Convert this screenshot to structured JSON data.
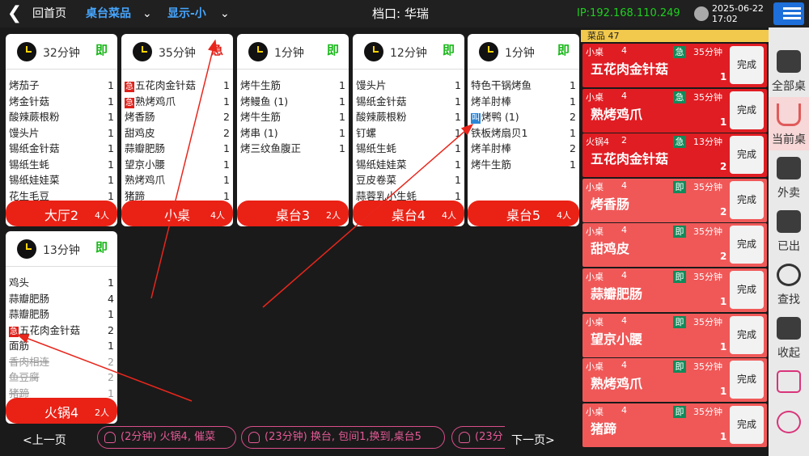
{
  "topbar": {
    "back": "❮",
    "home": "回首页",
    "menu": "桌台菜品",
    "display": "显示-小",
    "chevron": "⌄",
    "stall": "档口: 华瑞",
    "ip": "IP:192.168.110.249",
    "date": "2025-06-22",
    "time": "17:02"
  },
  "cards": [
    {
      "minutes": "32分钟",
      "tag": "即",
      "table": "大厅2",
      "people": "4人",
      "items": [
        {
          "n": "烤茄子",
          "q": "1"
        },
        {
          "n": "烤金针菇",
          "q": "1"
        },
        {
          "n": "酸辣蕨根粉",
          "q": "1"
        },
        {
          "n": "馒头片",
          "q": "1"
        },
        {
          "n": "锡纸金针菇",
          "q": "1"
        },
        {
          "n": "锡纸生蚝",
          "q": "1"
        },
        {
          "n": "锡纸娃娃菜",
          "q": "1"
        },
        {
          "n": "花生毛豆",
          "q": "1"
        }
      ]
    },
    {
      "minutes": "35分钟",
      "tag": "急",
      "table": "小桌",
      "people": "4人",
      "items": [
        {
          "b": "急",
          "n": "五花肉金针菇",
          "q": "1"
        },
        {
          "b": "急",
          "n": "熟烤鸡爪",
          "q": "1"
        },
        {
          "n": "烤香肠",
          "q": "2"
        },
        {
          "n": "甜鸡皮",
          "q": "2"
        },
        {
          "n": "蒜瓣肥肠",
          "q": "1"
        },
        {
          "n": "望京小腰",
          "q": "1"
        },
        {
          "n": "熟烤鸡爪",
          "q": "1"
        },
        {
          "n": "猪蹄",
          "q": "1"
        }
      ]
    },
    {
      "minutes": "1分钟",
      "tag": "即",
      "table": "桌台3",
      "people": "2人",
      "items": [
        {
          "n": "烤牛生筋",
          "q": "1"
        },
        {
          "n": "烤鳗鱼 (1)",
          "q": "1"
        },
        {
          "n": "烤牛生筋",
          "q": "1"
        },
        {
          "n": "烤串 (1)",
          "q": "1"
        },
        {
          "n": "烤三纹鱼腹正",
          "q": "1"
        }
      ]
    },
    {
      "minutes": "12分钟",
      "tag": "即",
      "table": "桌台4",
      "people": "4人",
      "items": [
        {
          "n": "馒头片",
          "q": "1"
        },
        {
          "n": "锡纸金针菇",
          "q": "1"
        },
        {
          "n": "酸辣蕨根粉",
          "q": "1"
        },
        {
          "n": "钉螺",
          "q": "1"
        },
        {
          "n": "锡纸生蚝",
          "q": "1"
        },
        {
          "n": "锡纸娃娃菜",
          "q": "1"
        },
        {
          "n": "豆皮卷菜",
          "q": "1"
        },
        {
          "n": "蒜蓉乳小生蚝",
          "q": "1"
        }
      ]
    },
    {
      "minutes": "1分钟",
      "tag": "即",
      "table": "桌台5",
      "people": "4人",
      "items": [
        {
          "n": "特色干锅烤鱼",
          "q": "1"
        },
        {
          "n": "烤羊肘棒",
          "q": "1"
        },
        {
          "b": "叫",
          "n": "烤鸭 (1)",
          "q": "2"
        },
        {
          "n": "铁板烤扇贝1",
          "q": "1"
        },
        {
          "n": "烤羊肘棒",
          "q": "2"
        },
        {
          "n": "烤牛生筋",
          "q": "1"
        }
      ]
    },
    {
      "minutes": "13分钟",
      "tag": "即",
      "table": "火锅4",
      "people": "2人",
      "items": [
        {
          "n": "鸡头",
          "q": "1"
        },
        {
          "n": "蒜瓣肥肠",
          "q": "4"
        },
        {
          "n": "蒜瓣肥肠",
          "q": "1"
        },
        {
          "b": "急",
          "n": "五花肉金针菇",
          "q": "2"
        },
        {
          "n": "面筋",
          "q": "1"
        },
        {
          "n": "香肉相连",
          "q": "2",
          "s": true
        },
        {
          "n": "鱼豆腐",
          "q": "2",
          "s": true
        },
        {
          "n": "猪蹄",
          "q": "1",
          "s": true
        }
      ]
    }
  ],
  "bottombar": {
    "prev": "<上一页",
    "next": "下一页>",
    "messages": [
      "(2分钟) 火锅4, 催菜",
      "(23分钟) 换台, 包间1,换到,桌台5",
      "(23分"
    ]
  },
  "orders": {
    "header": "菜品 47",
    "done_label": "完成",
    "list": [
      {
        "table": "小桌",
        "people": "4",
        "type": "急",
        "minutes": "35分钟",
        "dish": "五花肉金针菇",
        "qty": "1",
        "urgent": true
      },
      {
        "table": "小桌",
        "people": "4",
        "type": "急",
        "minutes": "35分钟",
        "dish": "熟烤鸡爪",
        "qty": "1",
        "urgent": true
      },
      {
        "table": "火锅4",
        "people": "2",
        "type": "急",
        "minutes": "13分钟",
        "dish": "五花肉金针菇",
        "qty": "2",
        "urgent": true
      },
      {
        "table": "小桌",
        "people": "4",
        "type": "即",
        "minutes": "35分钟",
        "dish": "烤香肠",
        "qty": "2"
      },
      {
        "table": "小桌",
        "people": "4",
        "type": "即",
        "minutes": "35分钟",
        "dish": "甜鸡皮",
        "qty": "2"
      },
      {
        "table": "小桌",
        "people": "4",
        "type": "即",
        "minutes": "35分钟",
        "dish": "蒜瓣肥肠",
        "qty": "1"
      },
      {
        "table": "小桌",
        "people": "4",
        "type": "即",
        "minutes": "35分钟",
        "dish": "望京小腰",
        "qty": "1"
      },
      {
        "table": "小桌",
        "people": "4",
        "type": "即",
        "minutes": "35分钟",
        "dish": "熟烤鸡爪",
        "qty": "1"
      },
      {
        "table": "小桌",
        "people": "4",
        "type": "即",
        "minutes": "35分钟",
        "dish": "猪蹄",
        "qty": "1"
      }
    ]
  },
  "sidebar": {
    "items": [
      {
        "label": "全部桌",
        "icon": "layers-icon"
      },
      {
        "label": "当前桌",
        "icon": "pot-icon"
      },
      {
        "label": "外卖",
        "icon": "scooter-icon"
      },
      {
        "label": "已出",
        "icon": "served-icon"
      },
      {
        "label": "查找",
        "icon": "search-icon"
      },
      {
        "label": "收起",
        "icon": "collapse-icon"
      },
      {
        "label": "",
        "icon": "chat-icon"
      },
      {
        "label": "",
        "icon": "voice-icon"
      }
    ]
  },
  "colors": {
    "urgent": "#e01d23",
    "normal": "#f05858",
    "accent": "#46a6ff",
    "ip": "#1fd01f"
  }
}
